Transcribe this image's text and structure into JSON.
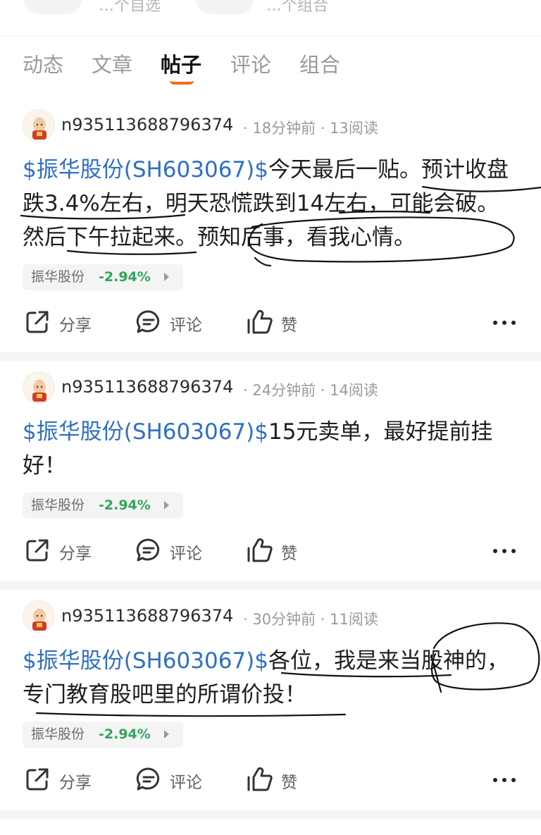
{
  "header": {
    "partial_left": "…个自选",
    "partial_right": "…个组合"
  },
  "tabs": [
    {
      "label": "动态"
    },
    {
      "label": "文章"
    },
    {
      "label": "帖子"
    },
    {
      "label": "评论"
    },
    {
      "label": "组合"
    }
  ],
  "active_tab": "帖子",
  "posts": [
    {
      "username": "n935113688796374",
      "meta": "· 18分钟前 · 13阅读",
      "stock_tag": "$振华股份(SH603067)$",
      "text": "今天最后一贴。预计收盘跌3.4%左右，明天恐慌跌到14左右，可能会破。然后下午拉起来。预知后事，看我心情。",
      "chip_name": "振华股份",
      "chip_change": "-2.94%",
      "share_label": "分享",
      "comment_label": "评论",
      "like_label": "赞"
    },
    {
      "username": "n935113688796374",
      "meta": "· 24分钟前 · 14阅读",
      "stock_tag": "$振华股份(SH603067)$",
      "text": "15元卖单，最好提前挂好！",
      "chip_name": "振华股份",
      "chip_change": "-2.94%",
      "share_label": "分享",
      "comment_label": "评论",
      "like_label": "赞"
    },
    {
      "username": "n935113688796374",
      "meta": "· 30分钟前 · 11阅读",
      "stock_tag": "$振华股份(SH603067)$",
      "text": "各位，我是来当股神的，专门教育股吧里的所谓价投！",
      "chip_name": "振华股份",
      "chip_change": "-2.94%",
      "share_label": "分享",
      "comment_label": "评论",
      "like_label": "赞"
    }
  ],
  "colors": {
    "stock_link": "#2f6fc5",
    "change_value": "#2fa65a",
    "tab_indicator": "#f06a22"
  },
  "icons": [
    "share-icon",
    "comment-icon",
    "like-icon",
    "more-icon",
    "avatar-icon",
    "chevron-right-icon"
  ]
}
